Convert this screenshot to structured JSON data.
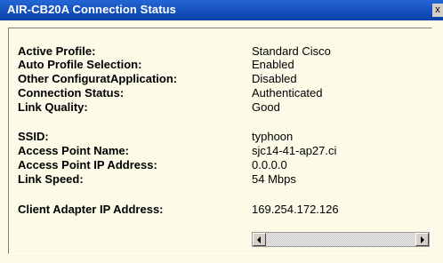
{
  "window": {
    "title": "AIR-CB20A Connection Status",
    "close_glyph": "x"
  },
  "status_rows": [
    {
      "label": "Active Profile:",
      "value": "Standard Cisco"
    },
    {
      "label": "Auto Profile Selection:",
      "value": "Enabled"
    },
    {
      "label": "Other ConfiguratApplication:",
      "value": "Disabled"
    },
    {
      "label": "Connection Status:",
      "value": "Authenticated"
    },
    {
      "label": "Link Quality:",
      "value": "Good"
    },
    {
      "label": "SSID:",
      "value": "typhoon"
    },
    {
      "label": "Access Point Name:",
      "value": "sjc14-41-ap27.ci"
    },
    {
      "label": "Access Point IP Address:",
      "value": "0.0.0.0"
    },
    {
      "label": "Link Speed:",
      "value": "54 Mbps"
    },
    {
      "label": "Client Adapter IP Address:",
      "value": "169.254.172.126"
    }
  ],
  "icons": {
    "close": "close-icon",
    "scroll_left": "arrow-left-icon",
    "scroll_right": "arrow-right-icon"
  },
  "colors": {
    "titlebar": "#0a3fa8",
    "background": "#fbfbe8"
  }
}
